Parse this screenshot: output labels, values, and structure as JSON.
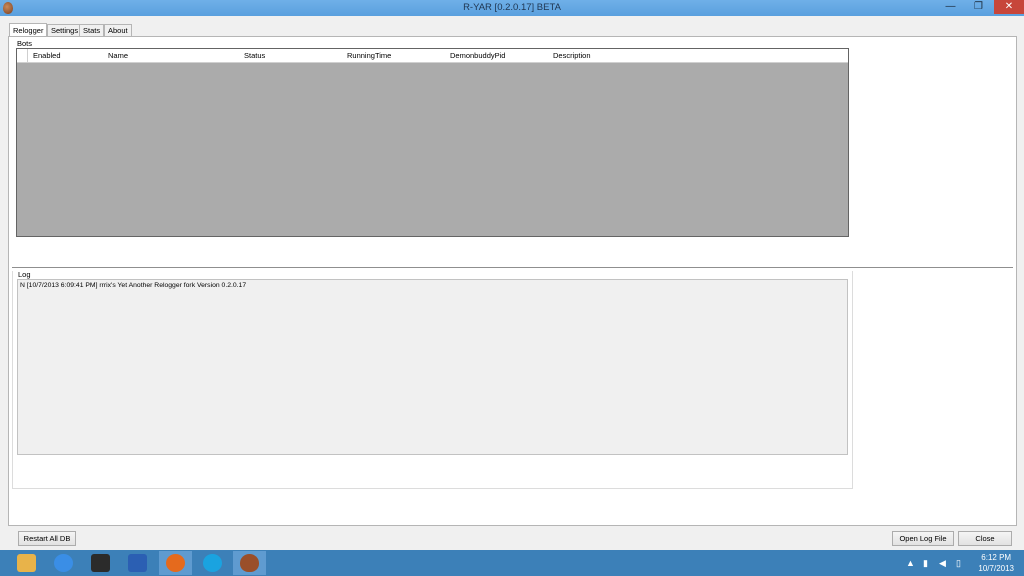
{
  "window": {
    "title": "R-YAR [0.2.0.17] BETA",
    "controls": {
      "minimize": "—",
      "maximize": "❐",
      "close": "✕"
    }
  },
  "tabs": [
    {
      "label": "Relogger",
      "active": true
    },
    {
      "label": "Settings",
      "active": false
    },
    {
      "label": "Stats",
      "active": false
    },
    {
      "label": "About",
      "active": false
    }
  ],
  "bots": {
    "group_label": "Bots",
    "columns": [
      "Enabled",
      "Name",
      "Status",
      "RunningTime",
      "DemonbuddyPid",
      "Description"
    ],
    "rows": []
  },
  "log": {
    "group_label": "Log",
    "lines": [
      "N [10/7/2013 6:09:41 PM] rrrix's Yet Another Relogger fork Version 0.2.0.17"
    ]
  },
  "buttons": {
    "restart_all_db": "Restart All DB",
    "open_log_file": "Open Log File",
    "close": "Close"
  },
  "taskbar": {
    "apps": [
      {
        "icon": "file-explorer-icon",
        "color": "#e8b34a"
      },
      {
        "icon": "internet-explorer-icon",
        "color": "#3a8ee6"
      },
      {
        "icon": "pointer-app-icon",
        "color": "#2b2b2b"
      },
      {
        "icon": "word-icon",
        "color": "#2b5fb3"
      },
      {
        "icon": "firefox-icon",
        "color": "#e56a1d"
      },
      {
        "icon": "skype-icon",
        "color": "#1aa3e0"
      },
      {
        "icon": "r-yar-app-icon",
        "color": "#9a4f2a"
      }
    ],
    "time": "6:12 PM",
    "date": "10/7/2013"
  }
}
